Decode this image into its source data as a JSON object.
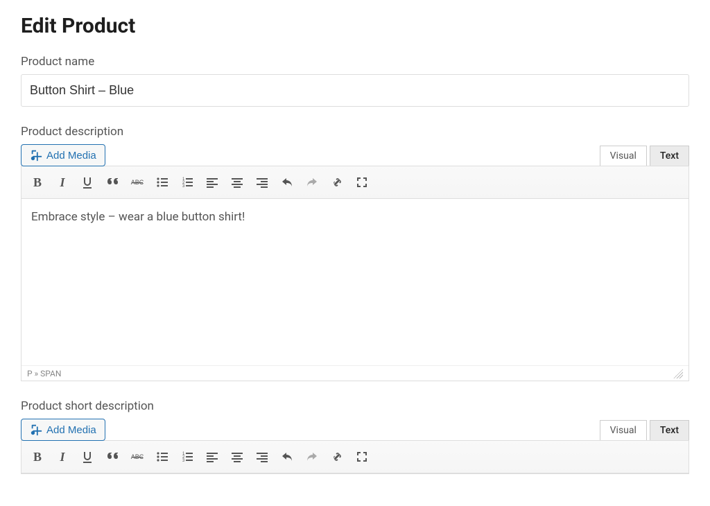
{
  "page": {
    "title": "Edit Product"
  },
  "labels": {
    "product_name": "Product name",
    "product_description": "Product description",
    "product_short_description": "Product short description"
  },
  "product_name_value": "Button Shirt – Blue",
  "add_media_label": "Add Media",
  "tabs": {
    "visual": "Visual",
    "text": "Text"
  },
  "editor1": {
    "content": "Embrace style – wear a blue button shirt!",
    "path": "P » SPAN"
  },
  "editor2": {
    "content": "",
    "path": ""
  },
  "toolbar_buttons": [
    {
      "name": "bold-button",
      "icon": "bold",
      "tip": "Bold"
    },
    {
      "name": "italic-button",
      "icon": "italic",
      "tip": "Italic"
    },
    {
      "name": "underline-button",
      "icon": "underline",
      "tip": "Underline"
    },
    {
      "name": "blockquote-button",
      "icon": "quote",
      "tip": "Blockquote"
    },
    {
      "name": "strikethrough-button",
      "icon": "strike",
      "tip": "Strikethrough"
    },
    {
      "name": "bullet-list-button",
      "icon": "ul",
      "tip": "Bulleted list"
    },
    {
      "name": "numbered-list-button",
      "icon": "ol",
      "tip": "Numbered list"
    },
    {
      "name": "align-left-button",
      "icon": "align-left",
      "tip": "Align left"
    },
    {
      "name": "align-center-button",
      "icon": "align-center",
      "tip": "Align center"
    },
    {
      "name": "align-right-button",
      "icon": "align-right",
      "tip": "Align right"
    },
    {
      "name": "undo-button",
      "icon": "undo",
      "tip": "Undo"
    },
    {
      "name": "redo-button",
      "icon": "redo",
      "tip": "Redo",
      "muted": true
    },
    {
      "name": "insert-link-button",
      "icon": "link",
      "tip": "Insert link"
    },
    {
      "name": "fullscreen-button",
      "icon": "fullscreen",
      "tip": "Fullscreen"
    }
  ]
}
